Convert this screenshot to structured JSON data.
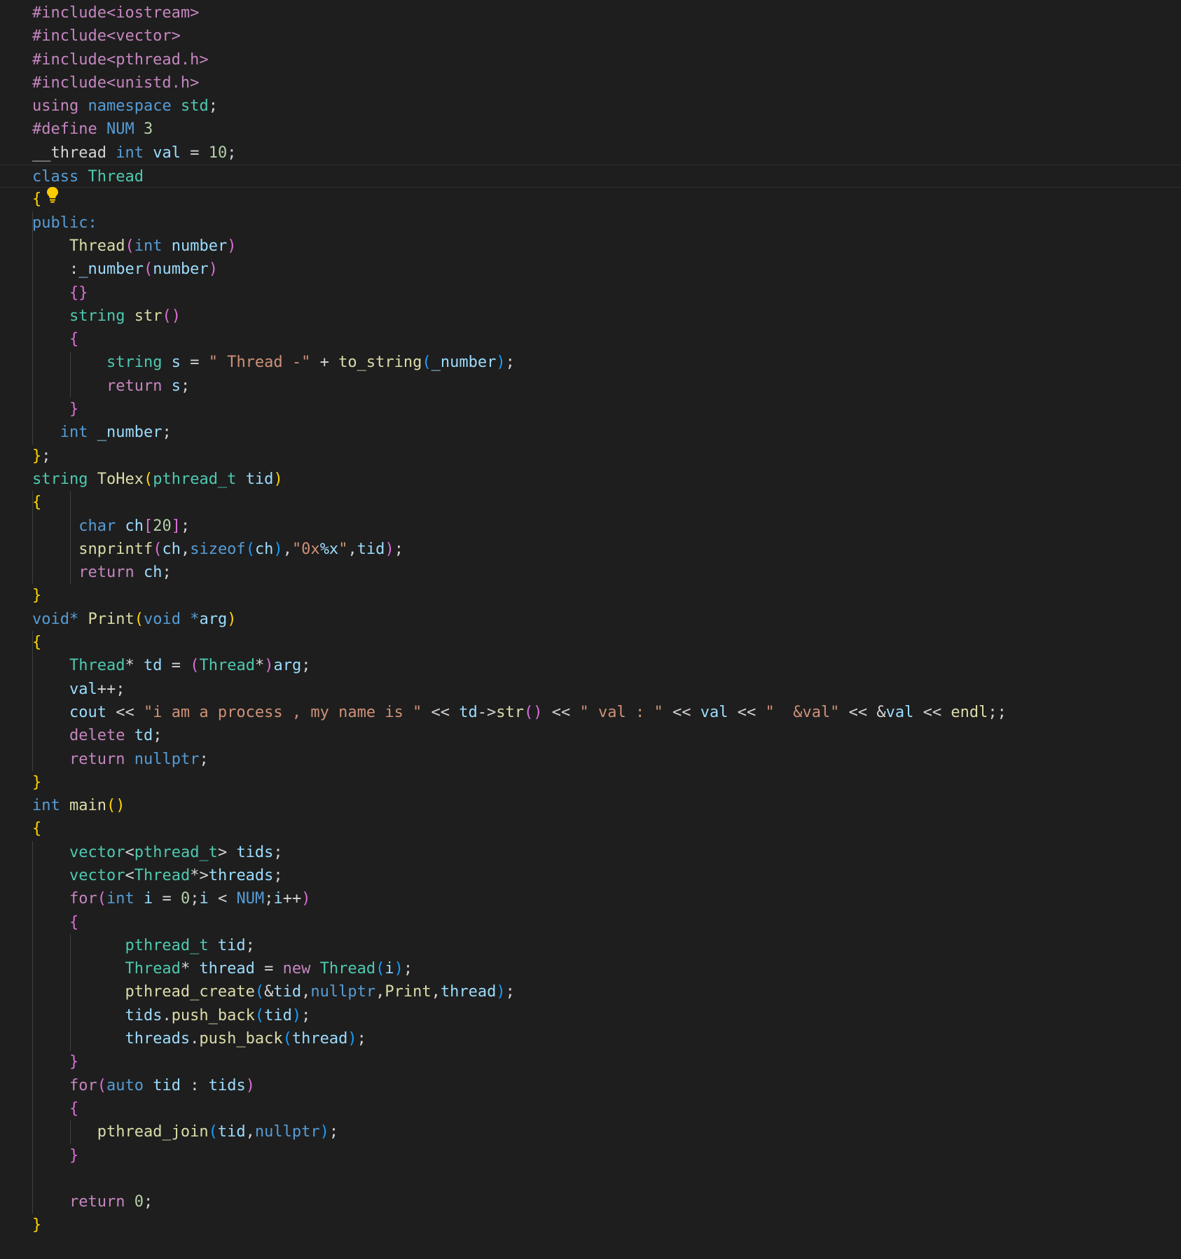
{
  "editor": {
    "theme": "dark",
    "background": "#1e1e1e",
    "current_line": 8,
    "lightbulb_line": 9,
    "colors": {
      "preprocessor": "#c586c0",
      "keyword": "#569cd6",
      "control": "#c586c0",
      "type": "#4ec9b0",
      "function": "#dcdcaa",
      "variable": "#9cdcfe",
      "number": "#b5cea8",
      "string": "#ce9178",
      "bracket_1": "#ffd700",
      "bracket_2": "#da70d6",
      "bracket_3": "#179fff"
    },
    "icons": [
      "lightbulb-icon"
    ],
    "lines": [
      [
        [
          "pp",
          "#include<iostream>"
        ]
      ],
      [
        [
          "pp",
          "#include<vector>"
        ]
      ],
      [
        [
          "pp",
          "#include<pthread.h>"
        ]
      ],
      [
        [
          "pp",
          "#include<unistd.h>"
        ]
      ],
      [
        [
          "ctl",
          "using"
        ],
        [
          "p",
          " "
        ],
        [
          "kw",
          "namespace"
        ],
        [
          "p",
          " "
        ],
        [
          "type",
          "std"
        ],
        [
          "p",
          ";"
        ]
      ],
      [
        [
          "pp",
          "#define"
        ],
        [
          "p",
          " "
        ],
        [
          "macro",
          "NUM"
        ],
        [
          "p",
          " "
        ],
        [
          "num",
          "3"
        ]
      ],
      [
        [
          "p",
          "__thread"
        ],
        [
          "p",
          " "
        ],
        [
          "kw",
          "int"
        ],
        [
          "p",
          " "
        ],
        [
          "var",
          "val"
        ],
        [
          "p",
          " = "
        ],
        [
          "num",
          "10"
        ],
        [
          "p",
          ";"
        ]
      ],
      [
        [
          "kw",
          "class"
        ],
        [
          "p",
          " "
        ],
        [
          "type",
          "Thread"
        ]
      ],
      [
        [
          "b1",
          "{"
        ]
      ],
      [
        [
          "kw",
          "public:"
        ]
      ],
      [
        [
          "p",
          "    "
        ],
        [
          "fn",
          "Thread"
        ],
        [
          "b2",
          "("
        ],
        [
          "kw",
          "int"
        ],
        [
          "p",
          " "
        ],
        [
          "var",
          "number"
        ],
        [
          "b2",
          ")"
        ]
      ],
      [
        [
          "p",
          "    "
        ],
        [
          "p",
          ":"
        ],
        [
          "var",
          "_number"
        ],
        [
          "b2",
          "("
        ],
        [
          "var",
          "number"
        ],
        [
          "b2",
          ")"
        ]
      ],
      [
        [
          "p",
          "    "
        ],
        [
          "b2",
          "{}"
        ]
      ],
      [
        [
          "p",
          "    "
        ],
        [
          "type",
          "string"
        ],
        [
          "p",
          " "
        ],
        [
          "fn",
          "str"
        ],
        [
          "b2",
          "()"
        ]
      ],
      [
        [
          "p",
          "    "
        ],
        [
          "b2",
          "{"
        ]
      ],
      [
        [
          "p",
          "        "
        ],
        [
          "type",
          "string"
        ],
        [
          "p",
          " "
        ],
        [
          "var",
          "s"
        ],
        [
          "p",
          " = "
        ],
        [
          "str",
          "\" Thread -\""
        ],
        [
          "p",
          " + "
        ],
        [
          "fn",
          "to_string"
        ],
        [
          "b3",
          "("
        ],
        [
          "var",
          "_number"
        ],
        [
          "b3",
          ")"
        ],
        [
          "p",
          ";"
        ]
      ],
      [
        [
          "p",
          "        "
        ],
        [
          "ctl",
          "return"
        ],
        [
          "p",
          " "
        ],
        [
          "var",
          "s"
        ],
        [
          "p",
          ";"
        ]
      ],
      [
        [
          "p",
          "    "
        ],
        [
          "b2",
          "}"
        ]
      ],
      [
        [
          "p",
          "   "
        ],
        [
          "kw",
          "int"
        ],
        [
          "p",
          " "
        ],
        [
          "var",
          "_number"
        ],
        [
          "p",
          ";"
        ]
      ],
      [
        [
          "b1",
          "}"
        ],
        [
          "p",
          ";"
        ]
      ],
      [
        [
          "type",
          "string"
        ],
        [
          "p",
          " "
        ],
        [
          "fn",
          "ToHex"
        ],
        [
          "b1",
          "("
        ],
        [
          "type",
          "pthread_t"
        ],
        [
          "p",
          " "
        ],
        [
          "var",
          "tid"
        ],
        [
          "b1",
          ")"
        ]
      ],
      [
        [
          "b1",
          "{"
        ]
      ],
      [
        [
          "p",
          "     "
        ],
        [
          "kw",
          "char"
        ],
        [
          "p",
          " "
        ],
        [
          "var",
          "ch"
        ],
        [
          "b2",
          "["
        ],
        [
          "num",
          "20"
        ],
        [
          "b2",
          "]"
        ],
        [
          "p",
          ";"
        ]
      ],
      [
        [
          "p",
          "     "
        ],
        [
          "fn",
          "snprintf"
        ],
        [
          "b2",
          "("
        ],
        [
          "var",
          "ch"
        ],
        [
          "p",
          ","
        ],
        [
          "kw",
          "sizeof"
        ],
        [
          "b3",
          "("
        ],
        [
          "var",
          "ch"
        ],
        [
          "b3",
          ")"
        ],
        [
          "p",
          ","
        ],
        [
          "str",
          "\"0x"
        ],
        [
          "strf",
          "%x"
        ],
        [
          "str",
          "\""
        ],
        [
          "p",
          ","
        ],
        [
          "var",
          "tid"
        ],
        [
          "b2",
          ")"
        ],
        [
          "p",
          ";"
        ]
      ],
      [
        [
          "p",
          "     "
        ],
        [
          "ctl",
          "return"
        ],
        [
          "p",
          " "
        ],
        [
          "var",
          "ch"
        ],
        [
          "p",
          ";"
        ]
      ],
      [
        [
          "b1",
          "}"
        ]
      ],
      [
        [
          "kw",
          "void"
        ],
        [
          "kw",
          "*"
        ],
        [
          "p",
          " "
        ],
        [
          "fn",
          "Print"
        ],
        [
          "b1",
          "("
        ],
        [
          "kw",
          "void"
        ],
        [
          "p",
          " "
        ],
        [
          "kw",
          "*"
        ],
        [
          "var",
          "arg"
        ],
        [
          "b1",
          ")"
        ]
      ],
      [
        [
          "b1",
          "{"
        ]
      ],
      [
        [
          "p",
          "    "
        ],
        [
          "type",
          "Thread"
        ],
        [
          "p",
          "* "
        ],
        [
          "var",
          "td"
        ],
        [
          "p",
          " = "
        ],
        [
          "b2",
          "("
        ],
        [
          "type",
          "Thread"
        ],
        [
          "p",
          "*"
        ],
        [
          "b2",
          ")"
        ],
        [
          "var",
          "arg"
        ],
        [
          "p",
          ";"
        ]
      ],
      [
        [
          "p",
          "    "
        ],
        [
          "var",
          "val"
        ],
        [
          "p",
          "++;"
        ]
      ],
      [
        [
          "p",
          "    "
        ],
        [
          "var",
          "cout"
        ],
        [
          "p",
          " << "
        ],
        [
          "str",
          "\"i am a process , my name is \""
        ],
        [
          "p",
          " << "
        ],
        [
          "var",
          "td"
        ],
        [
          "p",
          "->"
        ],
        [
          "fn",
          "str"
        ],
        [
          "b2",
          "()"
        ],
        [
          "p",
          " << "
        ],
        [
          "str",
          "\" val : \""
        ],
        [
          "p",
          " << "
        ],
        [
          "var",
          "val"
        ],
        [
          "p",
          " << "
        ],
        [
          "str",
          "\"  &val\""
        ],
        [
          "p",
          " << &"
        ],
        [
          "var",
          "val"
        ],
        [
          "p",
          " << "
        ],
        [
          "fn",
          "endl"
        ],
        [
          "p",
          ";;"
        ]
      ],
      [
        [
          "p",
          "    "
        ],
        [
          "ctl",
          "delete"
        ],
        [
          "p",
          " "
        ],
        [
          "var",
          "td"
        ],
        [
          "p",
          ";"
        ]
      ],
      [
        [
          "p",
          "    "
        ],
        [
          "ctl",
          "return"
        ],
        [
          "p",
          " "
        ],
        [
          "kw",
          "nullptr"
        ],
        [
          "p",
          ";"
        ]
      ],
      [
        [
          "b1",
          "}"
        ]
      ],
      [
        [
          "kw",
          "int"
        ],
        [
          "p",
          " "
        ],
        [
          "fn",
          "main"
        ],
        [
          "b1",
          "()"
        ]
      ],
      [
        [
          "b1",
          "{"
        ]
      ],
      [
        [
          "p",
          "    "
        ],
        [
          "type",
          "vector"
        ],
        [
          "p",
          "<"
        ],
        [
          "type",
          "pthread_t"
        ],
        [
          "p",
          "> "
        ],
        [
          "var",
          "tids"
        ],
        [
          "p",
          ";"
        ]
      ],
      [
        [
          "p",
          "    "
        ],
        [
          "type",
          "vector"
        ],
        [
          "p",
          "<"
        ],
        [
          "type",
          "Thread"
        ],
        [
          "p",
          "*>"
        ],
        [
          "var",
          "threads"
        ],
        [
          "p",
          ";"
        ]
      ],
      [
        [
          "p",
          "    "
        ],
        [
          "ctl",
          "for"
        ],
        [
          "b2",
          "("
        ],
        [
          "kw",
          "int"
        ],
        [
          "p",
          " "
        ],
        [
          "var",
          "i"
        ],
        [
          "p",
          " = "
        ],
        [
          "num",
          "0"
        ],
        [
          "p",
          ";"
        ],
        [
          "var",
          "i"
        ],
        [
          "p",
          " < "
        ],
        [
          "macro",
          "NUM"
        ],
        [
          "p",
          ";"
        ],
        [
          "var",
          "i"
        ],
        [
          "p",
          "++"
        ],
        [
          "b2",
          ")"
        ]
      ],
      [
        [
          "p",
          "    "
        ],
        [
          "b2",
          "{"
        ]
      ],
      [
        [
          "p",
          "          "
        ],
        [
          "type",
          "pthread_t"
        ],
        [
          "p",
          " "
        ],
        [
          "var",
          "tid"
        ],
        [
          "p",
          ";"
        ]
      ],
      [
        [
          "p",
          "          "
        ],
        [
          "type",
          "Thread"
        ],
        [
          "p",
          "* "
        ],
        [
          "var",
          "thread"
        ],
        [
          "p",
          " = "
        ],
        [
          "ctl",
          "new"
        ],
        [
          "p",
          " "
        ],
        [
          "type",
          "Thread"
        ],
        [
          "b3",
          "("
        ],
        [
          "var",
          "i"
        ],
        [
          "b3",
          ")"
        ],
        [
          "p",
          ";"
        ]
      ],
      [
        [
          "p",
          "          "
        ],
        [
          "fn",
          "pthread_create"
        ],
        [
          "b3",
          "("
        ],
        [
          "p",
          "&"
        ],
        [
          "var",
          "tid"
        ],
        [
          "p",
          ","
        ],
        [
          "kw",
          "nullptr"
        ],
        [
          "p",
          ","
        ],
        [
          "fn",
          "Print"
        ],
        [
          "p",
          ","
        ],
        [
          "var",
          "thread"
        ],
        [
          "b3",
          ")"
        ],
        [
          "p",
          ";"
        ]
      ],
      [
        [
          "p",
          "          "
        ],
        [
          "var",
          "tids"
        ],
        [
          "p",
          "."
        ],
        [
          "fn",
          "push_back"
        ],
        [
          "b3",
          "("
        ],
        [
          "var",
          "tid"
        ],
        [
          "b3",
          ")"
        ],
        [
          "p",
          ";"
        ]
      ],
      [
        [
          "p",
          "          "
        ],
        [
          "var",
          "threads"
        ],
        [
          "p",
          "."
        ],
        [
          "fn",
          "push_back"
        ],
        [
          "b3",
          "("
        ],
        [
          "var",
          "thread"
        ],
        [
          "b3",
          ")"
        ],
        [
          "p",
          ";"
        ]
      ],
      [
        [
          "p",
          "    "
        ],
        [
          "b2",
          "}"
        ]
      ],
      [
        [
          "p",
          "    "
        ],
        [
          "ctl",
          "for"
        ],
        [
          "b2",
          "("
        ],
        [
          "kw",
          "auto"
        ],
        [
          "p",
          " "
        ],
        [
          "var",
          "tid"
        ],
        [
          "p",
          " : "
        ],
        [
          "var",
          "tids"
        ],
        [
          "b2",
          ")"
        ]
      ],
      [
        [
          "p",
          "    "
        ],
        [
          "b2",
          "{"
        ]
      ],
      [
        [
          "p",
          "       "
        ],
        [
          "fn",
          "pthread_join"
        ],
        [
          "b3",
          "("
        ],
        [
          "var",
          "tid"
        ],
        [
          "p",
          ","
        ],
        [
          "kw",
          "nullptr"
        ],
        [
          "b3",
          ")"
        ],
        [
          "p",
          ";"
        ]
      ],
      [
        [
          "p",
          "    "
        ],
        [
          "b2",
          "}"
        ]
      ],
      [],
      [
        [
          "p",
          "    "
        ],
        [
          "ctl",
          "return"
        ],
        [
          "p",
          " "
        ],
        [
          "num",
          "0"
        ],
        [
          "p",
          ";"
        ]
      ],
      [
        [
          "b1",
          "}"
        ]
      ]
    ]
  }
}
